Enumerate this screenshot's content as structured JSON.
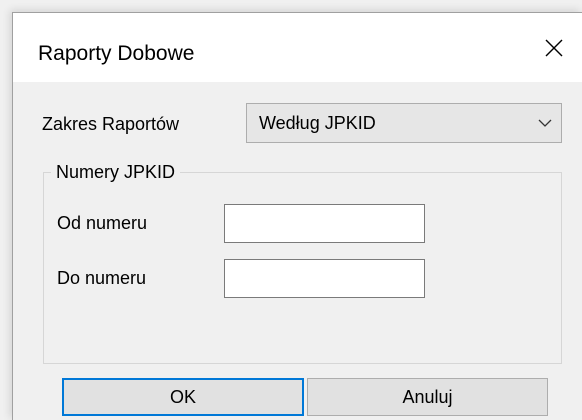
{
  "window": {
    "title": "Raporty Dobowe",
    "close_icon": "close-icon"
  },
  "form": {
    "range_label": "Zakres Raportów",
    "range_selected": "Według JPKID",
    "group_title": "Numery JPKID",
    "from_label": "Od numeru",
    "from_value": "",
    "to_label": "Do numeru",
    "to_value": ""
  },
  "buttons": {
    "ok_label": "OK",
    "cancel_label": "Anuluj"
  },
  "colors": {
    "focus_border": "#0078d7",
    "titlebar_bg": "#ffffff",
    "dialog_bg": "#f0f0f0"
  }
}
